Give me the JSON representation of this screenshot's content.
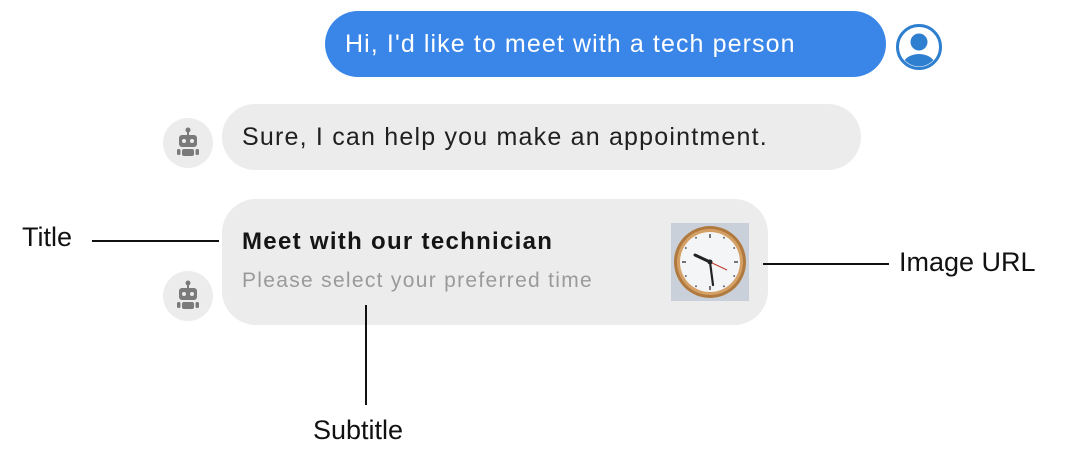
{
  "conversation": {
    "user_message": "Hi, I'd like to meet with a tech person",
    "bot_message": "Sure, I can help you make an appointment.",
    "card": {
      "title": "Meet with our technician",
      "subtitle": "Please select your preferred time",
      "image_icon": "wall-clock-image"
    },
    "avatars": {
      "user_icon": "user-avatar-icon",
      "bot_icon": "robot-avatar-icon"
    }
  },
  "annotations": {
    "title_label": "Title",
    "subtitle_label": "Subtitle",
    "image_url_label": "Image URL"
  },
  "colors": {
    "user_bubble": "#3a86e8",
    "bot_bubble": "#ececec",
    "card_subtitle": "#9a9a9a",
    "avatar_blue": "#2f7fd0"
  }
}
